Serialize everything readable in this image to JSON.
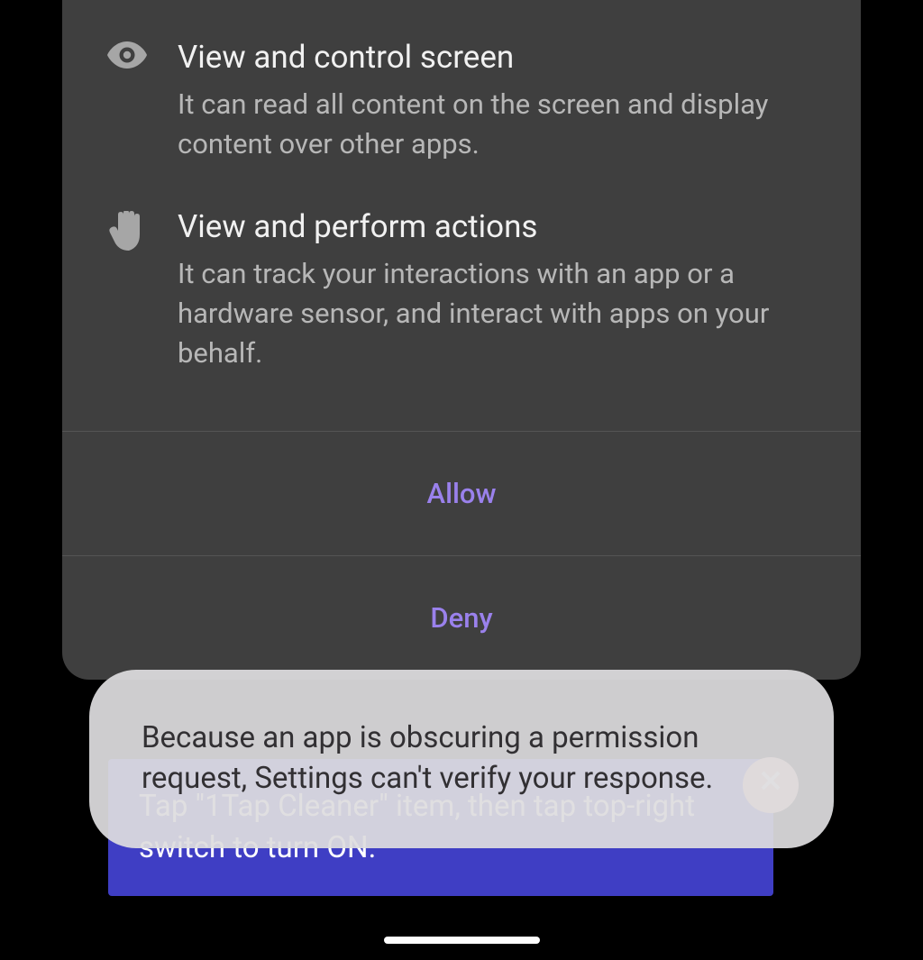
{
  "permissions": [
    {
      "title": "View and control screen",
      "description": "It can read all content on the screen and display content over other apps."
    },
    {
      "title": "View and perform actions",
      "description": "It can track your interactions with an app or a hardware sensor, and interact with apps on your behalf."
    }
  ],
  "buttons": {
    "allow": "Allow",
    "deny": "Deny"
  },
  "hint": {
    "text": "Tap \"1Tap Cleaner\" item, then tap top-right switch to turn ON."
  },
  "toast": {
    "message": "Because an app is obscuring a permission request, Settings can't verify your response."
  }
}
